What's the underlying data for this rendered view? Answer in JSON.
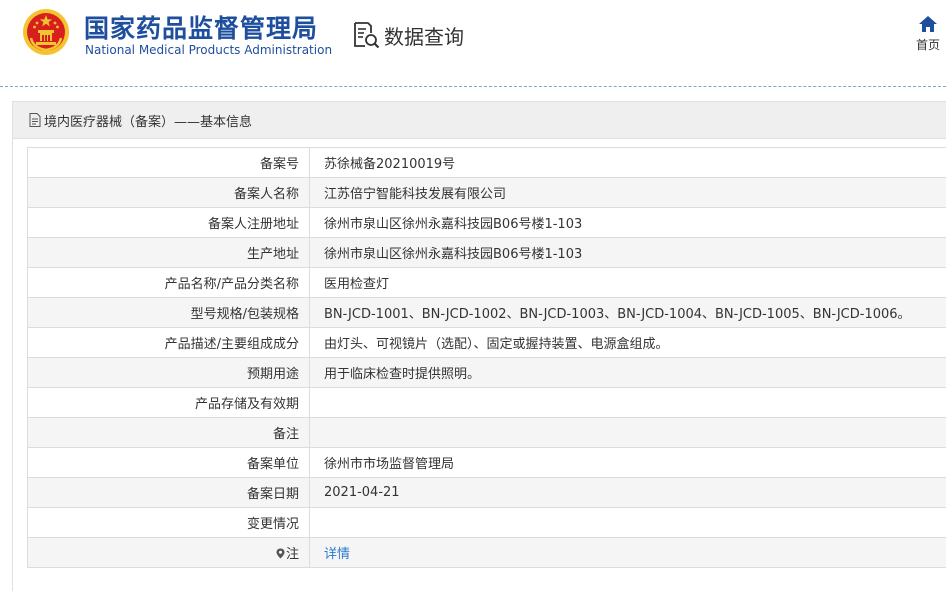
{
  "header": {
    "title_cn": "国家药品监督管理局",
    "title_en": "National Medical Products Administration",
    "query_label": "数据查询",
    "home_label": "首页"
  },
  "panel": {
    "title": "境内医疗器械（备案）——基本信息"
  },
  "rows": [
    {
      "label": "备案号",
      "value": "苏徐械备20210019号"
    },
    {
      "label": "备案人名称",
      "value": "江苏倍宁智能科技发展有限公司"
    },
    {
      "label": "备案人注册地址",
      "value": "徐州市泉山区徐州永嘉科技园B06号楼1-103"
    },
    {
      "label": "生产地址",
      "value": "徐州市泉山区徐州永嘉科技园B06号楼1-103"
    },
    {
      "label": "产品名称/产品分类名称",
      "value": "医用检查灯"
    },
    {
      "label": "型号规格/包装规格",
      "value": "BN-JCD-1001、BN-JCD-1002、BN-JCD-1003、BN-JCD-1004、BN-JCD-1005、BN-JCD-1006。"
    },
    {
      "label": "产品描述/主要组成成分",
      "value": "由灯头、可视镜片（选配）、固定或握持装置、电源盒组成。"
    },
    {
      "label": "预期用途",
      "value": "用于临床检查时提供照明。"
    },
    {
      "label": "产品存储及有效期",
      "value": ""
    },
    {
      "label": "备注",
      "value": ""
    },
    {
      "label": "备案单位",
      "value": "徐州市市场监督管理局"
    },
    {
      "label": "备案日期",
      "value": "2021-04-21"
    },
    {
      "label": "变更情况",
      "value": ""
    },
    {
      "label": "注",
      "value": "详情"
    }
  ],
  "colors": {
    "brand_blue": "#1e4e9e",
    "link_blue": "#2a7bd1",
    "emblem_red": "#d7201e",
    "emblem_gold": "#f4c430"
  },
  "icons": {
    "logo": "national-emblem-icon",
    "query": "search-document-icon",
    "home": "home-icon",
    "panel": "document-icon",
    "note": "pin-icon"
  }
}
